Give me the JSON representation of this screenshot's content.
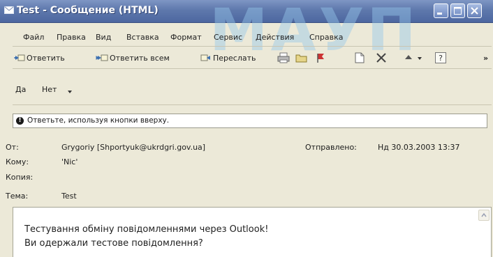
{
  "window": {
    "title": "Test - Сообщение (HTML)",
    "watermark": "МАУП"
  },
  "menu": [
    {
      "label": "Файл"
    },
    {
      "label": "Правка"
    },
    {
      "label": "Вид"
    },
    {
      "label": "Вставка"
    },
    {
      "label": "Формат"
    },
    {
      "label": "Сервис"
    },
    {
      "label": "Действия"
    },
    {
      "label": "Справка"
    }
  ],
  "toolbar": {
    "reply": "Ответить",
    "reply_all": "Ответить всем",
    "forward": "Переслать",
    "more": "»"
  },
  "voting": {
    "yes": "Да",
    "no": "Нет"
  },
  "infobar": {
    "text": "Ответьте, используя кнопки вверху."
  },
  "header": {
    "from_label": "От:",
    "from_value": "Grygoriy [Shportyuk@ukrdgri.gov.ua]",
    "sent_label": "Отправлено:",
    "sent_value": "Нд 30.03.2003 13:37",
    "to_label": "Кому:",
    "to_value": "'Nic'",
    "cc_label": "Копия:",
    "cc_value": "",
    "subject_label": "Тема:",
    "subject_value": "Test"
  },
  "body": {
    "lines": [
      "Тестування обміну повідомленнями через Outlook!",
      "Ви одержали тестове повідомлення?"
    ]
  },
  "colors": {
    "titlebar": "#5e78ac",
    "window_bg": "#ece9d8"
  }
}
